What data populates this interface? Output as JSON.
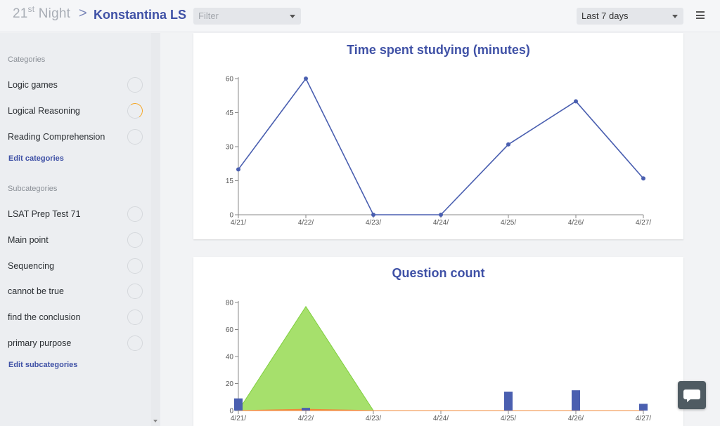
{
  "header": {
    "brand_number": "21",
    "brand_suffix": "st",
    "brand_name": "Night",
    "separator": ">",
    "title": "Konstantina LS",
    "filter_placeholder": "Filter",
    "range_value": "Last 7 days",
    "icons": {
      "filter_caret": "chevron-down-icon",
      "range_caret": "chevron-down-icon",
      "menu": "hamburger-menu-icon"
    }
  },
  "sidebar": {
    "categories_heading": "Categories",
    "categories": [
      {
        "label": "Logic games",
        "progress": 0
      },
      {
        "label": "Logical Reasoning",
        "progress": 0.45
      },
      {
        "label": "Reading Comprehension",
        "progress": 0
      }
    ],
    "edit_categories": "Edit categories",
    "subcategories_heading": "Subcategories",
    "subcategories": [
      {
        "label": "LSAT Prep Test 71",
        "progress": 0
      },
      {
        "label": "Main point",
        "progress": 0
      },
      {
        "label": "Sequencing",
        "progress": 0
      },
      {
        "label": "cannot be true",
        "progress": 0
      },
      {
        "label": "find the conclusion",
        "progress": 0
      },
      {
        "label": "primary purpose",
        "progress": 0
      }
    ],
    "edit_subcategories": "Edit subcategories"
  },
  "colors": {
    "accent": "#3f51a6",
    "line": "#4a5fb0",
    "area_green": "#a6e06c",
    "area_green_stroke": "#7fcf3e",
    "area_orange": "#f0883a",
    "progress_orange": "#f5a623"
  },
  "chart_data": [
    {
      "type": "line",
      "title": "Time spent studying (minutes)",
      "categories": [
        "4/21/",
        "4/22/",
        "4/23/",
        "4/24/",
        "4/25/",
        "4/26/",
        "4/27/"
      ],
      "values": [
        20,
        60,
        0,
        0,
        31,
        50,
        16
      ],
      "yticks": [
        0,
        15,
        30,
        45,
        60
      ],
      "ylim": [
        0,
        60
      ],
      "grid": false
    },
    {
      "type": "area",
      "title": "Question count",
      "categories": [
        "4/21/",
        "4/22/",
        "4/23/",
        "4/24/",
        "4/25/",
        "4/26/",
        "4/27/"
      ],
      "series": [
        {
          "values": [
            0,
            77,
            0,
            0,
            0,
            0,
            0
          ],
          "kind": "area",
          "color": "#a6e06c"
        },
        {
          "values": [
            0,
            1,
            0,
            0,
            0,
            0,
            0
          ],
          "kind": "area",
          "color": "#f0883a"
        },
        {
          "values": [
            9,
            2,
            0,
            0,
            14,
            15,
            5
          ],
          "kind": "bar",
          "color": "#4a5fb0"
        }
      ],
      "yticks": [
        0,
        20,
        40,
        60,
        80
      ],
      "ylim": [
        0,
        80
      ],
      "grid": false
    }
  ],
  "chat_icon": "chat-bubble-icon"
}
